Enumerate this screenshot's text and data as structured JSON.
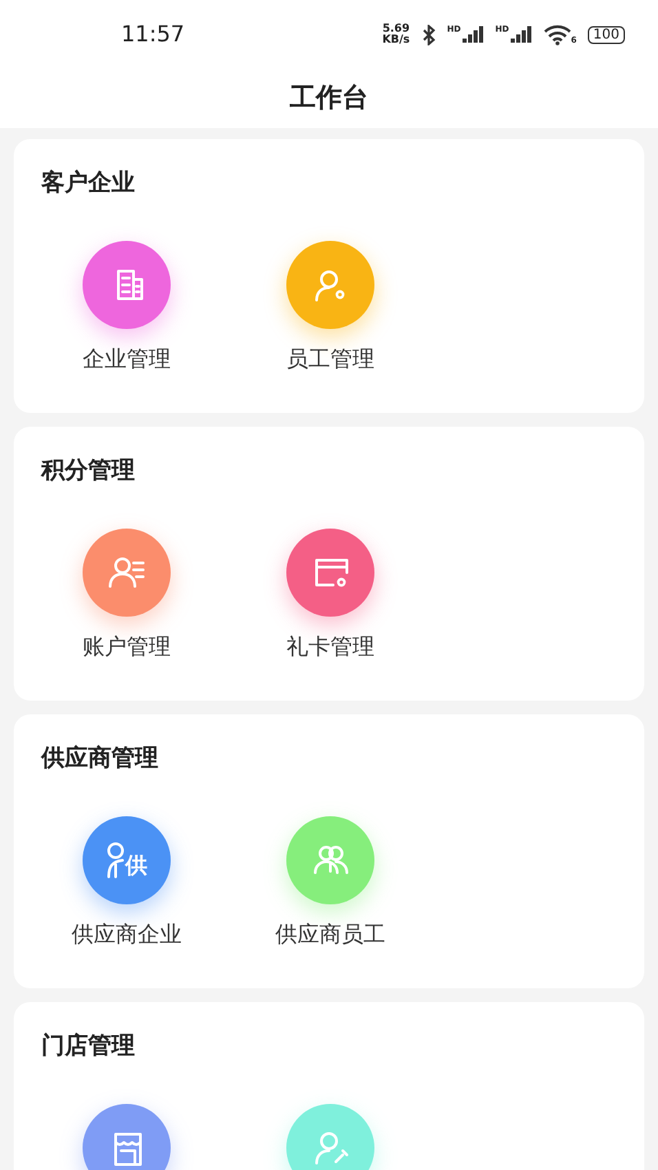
{
  "status_bar": {
    "time": "11:57",
    "net_speed": [
      "5.69",
      "KB/s"
    ],
    "signals": [
      {
        "label": "HD"
      },
      {
        "label": "HD"
      }
    ],
    "wifi_label": "6",
    "battery": "100"
  },
  "header": {
    "title": "工作台"
  },
  "sections": [
    {
      "title": "客户企业",
      "items": [
        {
          "label": "企业管理",
          "kind": "building",
          "color": "#ee66dd"
        },
        {
          "label": "员工管理",
          "kind": "user-gear",
          "color": "#f9b414"
        }
      ]
    },
    {
      "title": "积分管理",
      "items": [
        {
          "label": "账户管理",
          "kind": "user-list",
          "color": "#fb8d6c"
        },
        {
          "label": "礼卡管理",
          "kind": "card-gear",
          "color": "#f45f86"
        }
      ]
    },
    {
      "title": "供应商管理",
      "items": [
        {
          "label": "供应商企业",
          "kind": "user-text",
          "icon_text": "供",
          "color": "#4b92f5"
        },
        {
          "label": "供应商员工",
          "kind": "users",
          "color": "#86ee7c"
        }
      ]
    },
    {
      "title": "门店管理",
      "items": [
        {
          "kind": "store",
          "color": "#7f9cf5"
        },
        {
          "kind": "user-wrench",
          "color": "#7ff0dc"
        }
      ]
    }
  ]
}
